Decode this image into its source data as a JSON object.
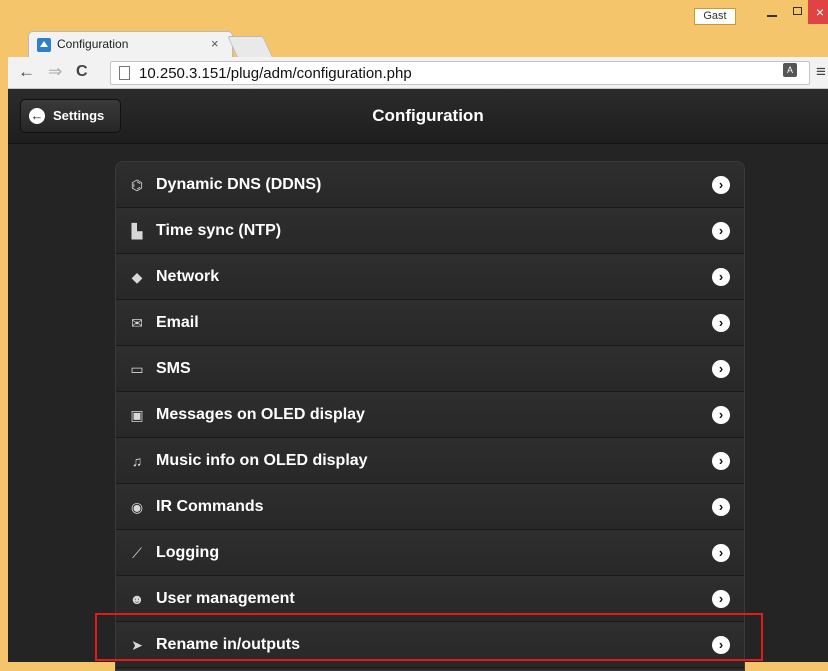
{
  "window": {
    "user_badge": "Gast",
    "min_label": "",
    "max_label": "",
    "close_label": "×"
  },
  "tab": {
    "title": "Configuration",
    "close_label": "×"
  },
  "toolbar": {
    "back_icon": "←",
    "forward_icon": "⇒",
    "reload_icon": "C",
    "url": "10.250.3.151/plug/adm/configuration.php",
    "menu_icon": "≡"
  },
  "header": {
    "back_label": "Settings",
    "back_icon": "←",
    "title": "Configuration"
  },
  "menu": {
    "items": [
      {
        "label": "Dynamic DNS (DDNS)",
        "icon": "network-nodes-icon",
        "glyph": "⌬"
      },
      {
        "label": "Time sync (NTP)",
        "icon": "server-clock-icon",
        "glyph": "▙"
      },
      {
        "label": "Network",
        "icon": "globe-icon",
        "glyph": "◆"
      },
      {
        "label": "Email",
        "icon": "envelope-icon",
        "glyph": "✉"
      },
      {
        "label": "SMS",
        "icon": "sms-icon",
        "glyph": "▭"
      },
      {
        "label": "Messages on OLED display",
        "icon": "display-icon",
        "glyph": "▣"
      },
      {
        "label": "Music info on OLED display",
        "icon": "music-note-icon",
        "glyph": "♫"
      },
      {
        "label": "IR Commands",
        "icon": "ir-signal-icon",
        "glyph": "◉"
      },
      {
        "label": "Logging",
        "icon": "chart-line-icon",
        "glyph": "⟋"
      },
      {
        "label": "User management",
        "icon": "user-icon",
        "glyph": "☻"
      },
      {
        "label": "Rename in/outputs",
        "icon": "rename-icon",
        "glyph": "➤"
      }
    ],
    "chevron": "›"
  }
}
